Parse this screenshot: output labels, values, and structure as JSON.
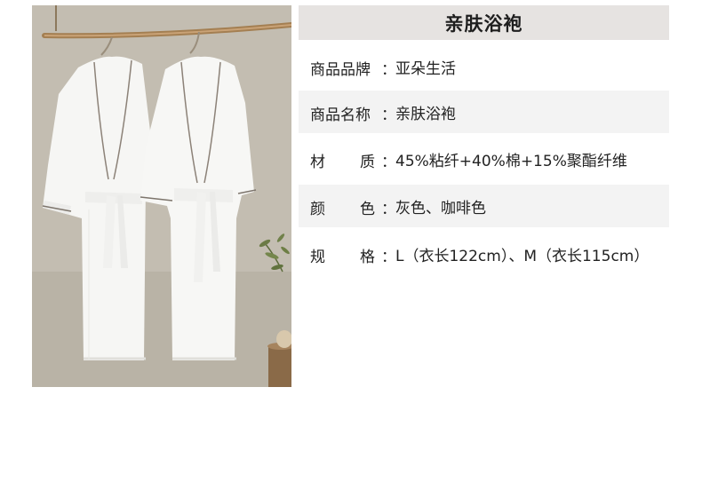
{
  "title": "亲肤浴袍",
  "specs": [
    {
      "label": "商品品牌",
      "char1": "",
      "char2": "",
      "colon": "：",
      "value": "亚朵生活"
    },
    {
      "label": "商品名称",
      "char1": "",
      "char2": "",
      "colon": "：",
      "value": "亲肤浴袍"
    },
    {
      "label": "",
      "char1": "材",
      "char2": "质",
      "colon": "：",
      "value": "45%粘纤+40%棉+15%聚酯纤维"
    },
    {
      "label": "",
      "char1": "颜",
      "char2": "色",
      "colon": "：",
      "value": "灰色、咖啡色"
    },
    {
      "label": "",
      "char1": "规",
      "char2": "格",
      "colon": "：",
      "value": "L（衣长122cm）、M（衣长115cm）"
    }
  ]
}
